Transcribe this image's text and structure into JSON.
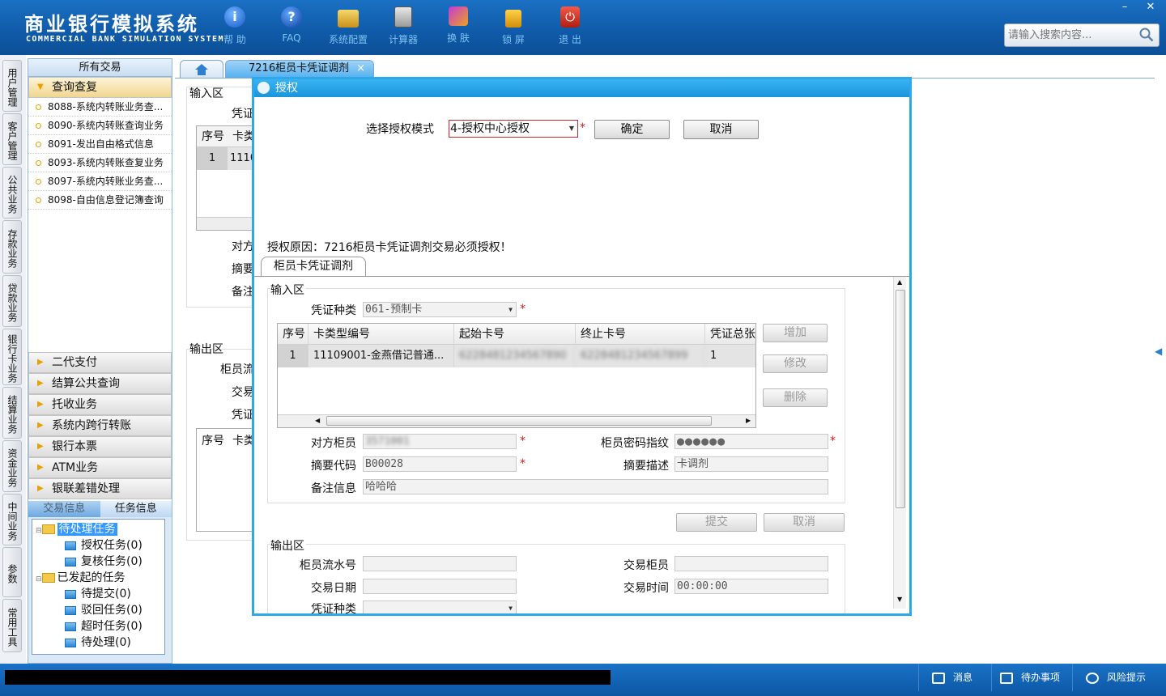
{
  "header": {
    "title_cn": "商业银行模拟系统",
    "title_en": "COMMERCIAL BANK SIMULATION SYSTEM",
    "toolbar": [
      {
        "label": "帮 助",
        "icon": "info-icon"
      },
      {
        "label": "FAQ",
        "icon": "help-icon"
      },
      {
        "label": "系统配置",
        "icon": "config-icon"
      },
      {
        "label": "计算器",
        "icon": "calculator-icon"
      },
      {
        "label": "换 肤",
        "icon": "skin-icon"
      },
      {
        "label": "锁 屏",
        "icon": "lock-icon"
      },
      {
        "label": "退 出",
        "icon": "power-icon"
      }
    ],
    "search_placeholder": "请输入搜索内容..."
  },
  "left_rail": [
    "用户管理",
    "客户管理",
    "公共业务",
    "存款业务",
    "贷款业务",
    "银行卡业务",
    "结算业务",
    "资金业务",
    "中间业务",
    "参数",
    "常用工具"
  ],
  "nav": {
    "header": "所有交易",
    "open_group": "查询查复",
    "items": [
      "8088-系统内转账业务查...",
      "8090-系统内转账查询业务",
      "8091-发出自由格式信息",
      "8093-系统内转账查复业务",
      "8097-系统内转账业务查...",
      "8098-自由信息登记簿查询"
    ],
    "groups": [
      "二代支付",
      "结算公共查询",
      "托收业务",
      "系统内跨行转账",
      "银行本票",
      "ATM业务",
      "银联差错处理"
    ],
    "bottom_tabs": [
      "交易信息",
      "任务信息"
    ],
    "tree": {
      "pending": "待处理任务",
      "pending_children": [
        "授权任务(0)",
        "复核任务(0)"
      ],
      "initiated": "已发起的任务",
      "initiated_children": [
        "待提交(0)",
        "驳回任务(0)",
        "超时任务(0)",
        "待处理(0)"
      ]
    }
  },
  "tabs": {
    "active": "7216柜员卡凭证调剂",
    "close": "×"
  },
  "background_form": {
    "input_area": "输入区",
    "voucher_label": "凭证",
    "col_seq": "序号",
    "col_card": "卡类",
    "row_seq": "1",
    "row_card": "1110",
    "counter_label": "对方",
    "abstract_label": "摘要",
    "remark_label": "备注",
    "output_area": "输出区",
    "teller_seq_label": "柜员流",
    "trans_label": "交易",
    "voucher2_label": "凭证",
    "col_seq2": "序号",
    "col_card2": "卡类"
  },
  "modal": {
    "title": "授权",
    "mode_label": "选择授权模式",
    "mode_value": "4-授权中心授权",
    "confirm": "确定",
    "cancel": "取消",
    "reason": "授权原因：7216柜员卡凭证调剂交易必须授权！",
    "inner_tab": "柜员卡凭证调剂",
    "input_area": "输入区",
    "voucher_type_label": "凭证种类",
    "voucher_type_value": "061-预制卡",
    "grid": {
      "headers": [
        "序号",
        "卡类型编号",
        "起始卡号",
        "终止卡号",
        "凭证总张"
      ],
      "row": [
        "1",
        "11109001-金燕借记普通...",
        "6228481234567890",
        "6228481234567899",
        "1"
      ]
    },
    "add": "增加",
    "modify": "修改",
    "delete": "删除",
    "counter_teller_label": "对方柜员",
    "counter_teller_value": "3571001",
    "pwd_label": "柜员密码指纹",
    "pwd_value": "●●●●●●",
    "abstract_code_label": "摘要代码",
    "abstract_code_value": "B00028",
    "abstract_desc_label": "摘要描述",
    "abstract_desc_value": "卡调剂",
    "remark_label": "备注信息",
    "remark_value": "哈哈哈",
    "submit": "提交",
    "cancel2": "取消",
    "output_area": "输出区",
    "teller_seq_label": "柜员流水号",
    "teller_seq_value": "",
    "trans_teller_label": "交易柜员",
    "trans_teller_value": "",
    "trans_date_label": "交易日期",
    "trans_date_value": "",
    "trans_time_label": "交易时间",
    "trans_time_value": "00:00:00",
    "voucher_type2_label": "凭证种类"
  },
  "status": {
    "message": "消息",
    "todo": "待办事项",
    "risk": "风险提示"
  }
}
